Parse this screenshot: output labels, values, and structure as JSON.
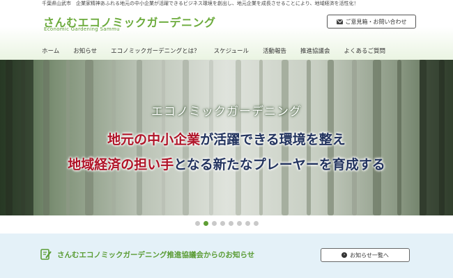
{
  "header": {
    "tagline": "千葉県山武市　企業家精神あふれる地元の中小企業が活躍できるビジネス環境を創出し、地元企業を成長させることにより、地域経済を活性化！",
    "logo": "さんむエコノミックガーデニング",
    "logo_sub": "Economic Gardening Sammu",
    "contact_label": "ご意見箱・お問い合わせ",
    "contact_icon": "mail-icon"
  },
  "nav": {
    "items": [
      {
        "label": "ホーム"
      },
      {
        "label": "お知らせ"
      },
      {
        "label": "エコノミックガーデニングとは？"
      },
      {
        "label": "スケジュール"
      },
      {
        "label": "活動報告"
      },
      {
        "label": "推進協議会"
      },
      {
        "label": "よくあるご質問"
      }
    ]
  },
  "hero": {
    "title": "エコノミックガーデニング",
    "line1_red": "地元の中小企業",
    "line1_rest": "が活躍できる環境を整え",
    "line2_red": "地域経済の担い手",
    "line2_rest": "となる新たなプレーヤーを育成する",
    "slide_count": 8,
    "active_slide": 2
  },
  "news": {
    "title": "さんむエコノミックガーデニング推進協議会からのお知らせ",
    "button_label": "お知らせ一覧へ",
    "icon": "note-icon"
  },
  "colors": {
    "brand_green": "#6cab3c",
    "accent_red": "#b01428",
    "accent_navy": "#22335e",
    "news_bg": "#e4f1f8"
  }
}
